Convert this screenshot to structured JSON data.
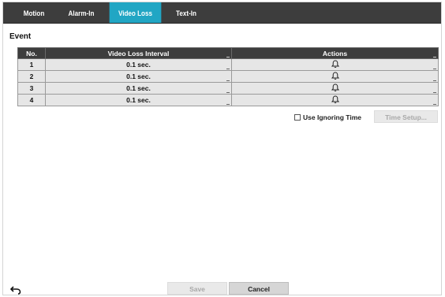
{
  "tabs": [
    {
      "label": "Motion",
      "active": false
    },
    {
      "label": "Alarm-In",
      "active": false
    },
    {
      "label": "Video Loss",
      "active": true
    },
    {
      "label": "Text-In",
      "active": false
    }
  ],
  "section_title": "Event",
  "table": {
    "columns": [
      "No.",
      "Video Loss Interval",
      "Actions"
    ],
    "rows": [
      {
        "no": "1",
        "interval": "0.1 sec.",
        "action_icon": "bell-icon"
      },
      {
        "no": "2",
        "interval": "0.1 sec.",
        "action_icon": "bell-icon"
      },
      {
        "no": "3",
        "interval": "0.1 sec.",
        "action_icon": "bell-icon"
      },
      {
        "no": "4",
        "interval": "0.1 sec.",
        "action_icon": "bell-icon"
      }
    ]
  },
  "ignoring": {
    "label": "Use Ignoring Time",
    "checked": false
  },
  "time_setup_label": "Time Setup...",
  "footer": {
    "save_label": "Save",
    "cancel_label": "Cancel",
    "back_icon": "back-arrow-icon"
  },
  "colors": {
    "accent": "#21a6c4",
    "header_bg": "#3d3d3d",
    "row_bg": "#e6e6e6"
  }
}
